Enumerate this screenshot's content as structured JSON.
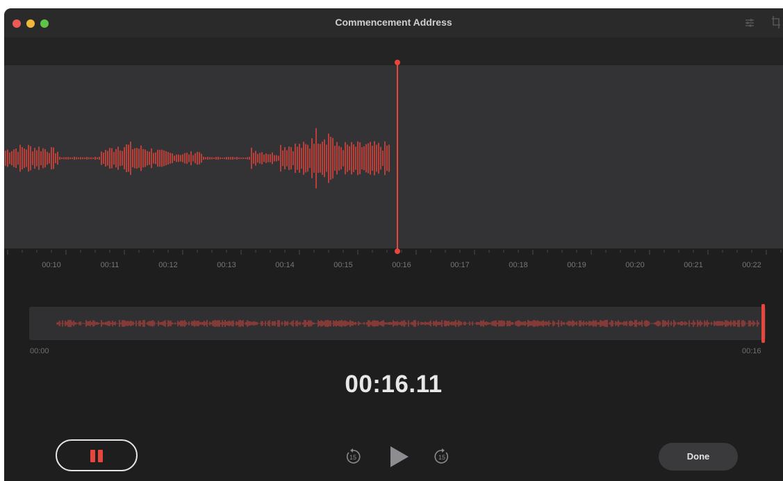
{
  "window": {
    "title": "Commencement Address",
    "icons": [
      "sliders-icon",
      "trim-icon"
    ],
    "traffic_lights": {
      "close": "#ec5a55",
      "minimize": "#f0b93a",
      "zoom": "#5fc249"
    }
  },
  "colors": {
    "accent": "#e5473c",
    "waveform": "#d9453b",
    "background": "#1e1e1f",
    "waveform_area": "#333335"
  },
  "timeline": {
    "ticks": [
      "00:10",
      "00:11",
      "00:12",
      "00:13",
      "00:14",
      "00:15",
      "00:16",
      "00:17",
      "00:18",
      "00:19",
      "00:20",
      "00:21",
      "00:22"
    ],
    "playhead_time": "00:16"
  },
  "overview": {
    "start_label": "00:00",
    "end_label": "00:16"
  },
  "recording": {
    "elapsed": "00:16.11"
  },
  "controls": {
    "skip_back_label": "15",
    "skip_forward_label": "15",
    "done_label": "Done",
    "pause_icon": "pause-icon",
    "play_icon": "play-icon"
  }
}
